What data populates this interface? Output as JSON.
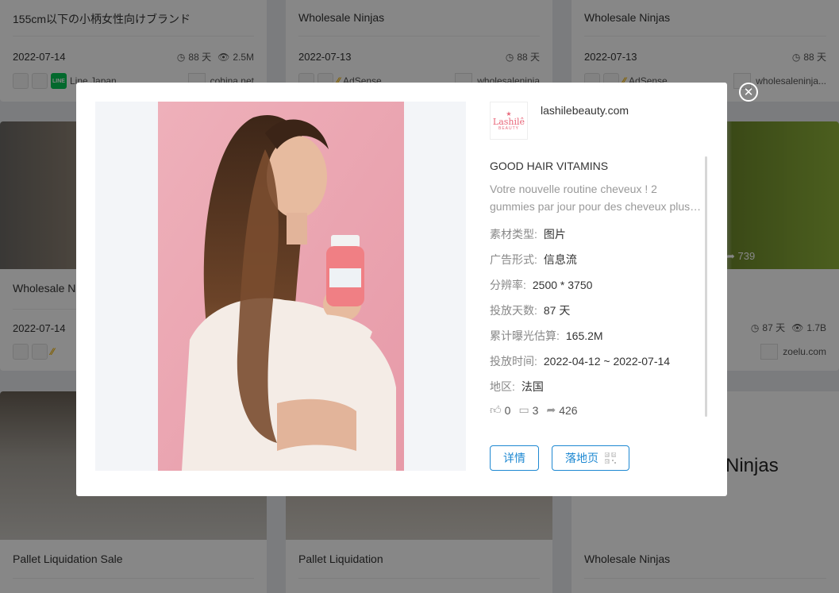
{
  "background_cards": [
    {
      "title": "155cm以下の小柄女性向けブランド",
      "date": "2022-07-14",
      "days": "88 天",
      "views": "2.5M",
      "platform_label": "Line Japan",
      "domain": "cohina.net"
    },
    {
      "title": "Wholesale Ninjas",
      "date": "2022-07-13",
      "days": "88 天",
      "platform_label": "AdSense",
      "domain": "wholesaleninja"
    },
    {
      "title": "Wholesale Ninjas",
      "date": "2022-07-13",
      "days": "88 天",
      "platform_label": "AdSense",
      "domain": "wholesaleninja..."
    },
    {
      "title": "Wholesale N",
      "date": "2022-07-14"
    },
    {
      "shares": "739",
      "days": "87 天",
      "views": "1.7B",
      "domain": "zoelu.com"
    },
    {
      "title": "Pallet Liquidation Sale"
    },
    {
      "title": "Pallet Liquidation"
    },
    {
      "title": "Wholesale Ninjas",
      "overlay_text": "Ninjas"
    }
  ],
  "modal": {
    "close_icon": "close-circle-icon",
    "brand": {
      "logo_text": "Lashilê",
      "logo_sub": "BEAUTY",
      "domain": "lashilebeauty.com"
    },
    "ad_title": "GOOD HAIR VITAMINS",
    "description_lines": [
      "Votre nouvelle routine cheveux ! 2",
      "gummies par jour pour des cheveux plus…"
    ],
    "fields": [
      {
        "key": "素材类型:",
        "value": "图片"
      },
      {
        "key": "广告形式:",
        "value": "信息流"
      },
      {
        "key": "分辨率:",
        "value": "2500 * 3750"
      },
      {
        "key": "投放天数:",
        "value": "87 天"
      },
      {
        "key": "累计曝光估算:",
        "value": "165.2M"
      },
      {
        "key": "投放时间:",
        "value": "2022-04-12 ~ 2022-07-14"
      },
      {
        "key": "地区:",
        "value": "法国"
      }
    ],
    "reactions": {
      "likes": "0",
      "comments": "3",
      "shares": "426"
    },
    "buttons": {
      "detail": "详情",
      "landing": "落地页"
    }
  }
}
